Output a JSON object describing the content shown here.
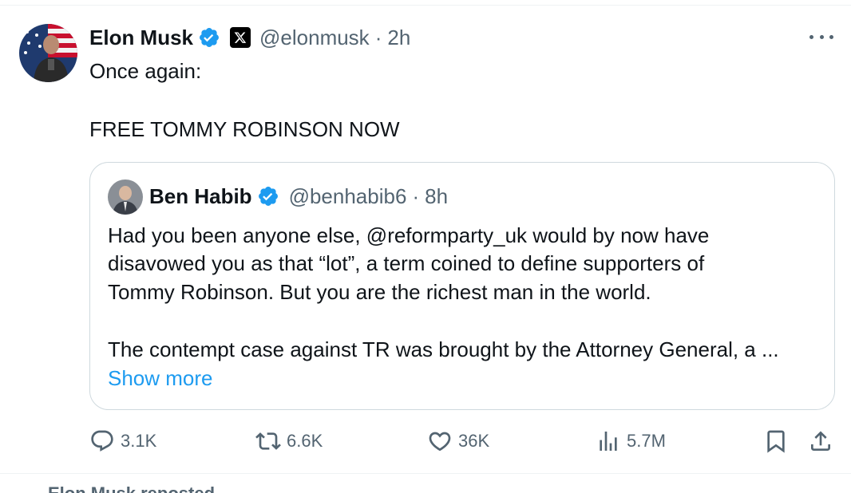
{
  "tweet": {
    "author_name": "Elon Musk",
    "handle": "@elonmusk",
    "separator": "·",
    "time": "2h",
    "text_line1": "Once again:",
    "text_line2": "FREE TOMMY ROBINSON NOW"
  },
  "quote": {
    "author_name": "Ben Habib",
    "handle": "@benhabib6",
    "separator": "·",
    "time": "8h",
    "line1": "Had you been anyone else, @reformparty_uk would by now have",
    "line2": "disavowed you as that “lot”, a term coined to define supporters of",
    "line3": "Tommy Robinson. But you are the richest man in the world.",
    "line4": "The contempt case against TR was brought by the Attorney General, a ...",
    "show_more": "Show more"
  },
  "actions": {
    "replies": "3.1K",
    "reposts": "6.6K",
    "likes": "36K",
    "views": "5.7M"
  },
  "next_peek": "Elon Musk reposted",
  "colors": {
    "text": "#0f1419",
    "secondary": "#536471",
    "link": "#1d9bf0",
    "verified": "#1d9bf0",
    "border": "#cfd9de"
  },
  "icons": [
    "verified-badge-icon",
    "x-affiliation-icon",
    "more-icon",
    "reply-icon",
    "repost-icon",
    "like-icon",
    "views-icon",
    "bookmark-icon",
    "share-icon"
  ]
}
